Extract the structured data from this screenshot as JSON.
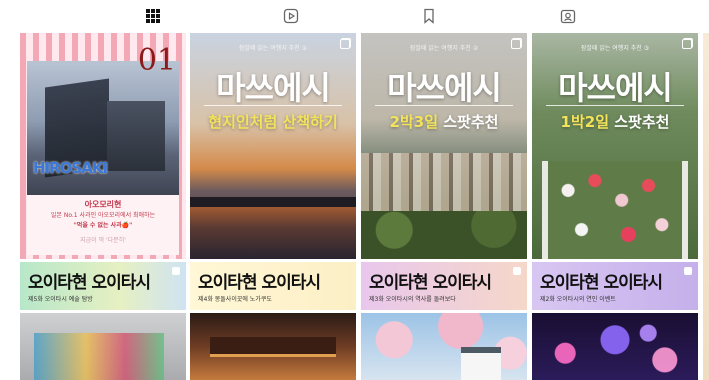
{
  "tabs": [
    {
      "icon": "grid-icon",
      "active": true
    },
    {
      "icon": "reels-icon",
      "active": false
    },
    {
      "icon": "bookmark-icon",
      "active": false
    },
    {
      "icon": "tagged-icon",
      "active": false
    }
  ],
  "posts_row1": [
    {
      "number": "01",
      "photo_sign": "HIROSAKI",
      "title": "아오모리현",
      "subtitle": "일본 No.1 사과인 아오모리에서 최애하는",
      "quote": "\"먹을 수 없는 사과🍎\"",
      "footer": "지금이 딱 '다분히'"
    },
    {
      "small": "잠잘때 읽는 여행지 추천 ①",
      "big": "마쓰에시",
      "sub_highlight": "현지인처럼 산책하기",
      "sub_rest": ""
    },
    {
      "small": "잠잘때 읽는 여행지 추천 ②",
      "big": "마쓰에시",
      "sub_highlight": "2박3일",
      "sub_rest": " 스팟추천"
    },
    {
      "small": "잠잘때 읽는 여행지 추천 ③",
      "big": "마쓰에시",
      "sub_highlight": "1박2일",
      "sub_rest": " 스팟추천"
    }
  ],
  "posts_row2": [
    {
      "title": "오이타현 오이타시",
      "sub": "제5화 오이타시 예술 탐방"
    },
    {
      "title": "오이타현 오이타시",
      "sub": "제4화 몽돌사이끗에 노가쿠도"
    },
    {
      "title": "오이타현 오이타시",
      "sub": "제3화 오이타시의 역사를 돌려보다"
    },
    {
      "title": "오이타현 오이타시",
      "sub": "제2화 오이타시의 연인 이벤트"
    }
  ],
  "colors": {
    "accent_pink": "#c2394d",
    "highlight_yellow": "#f2e35a"
  }
}
